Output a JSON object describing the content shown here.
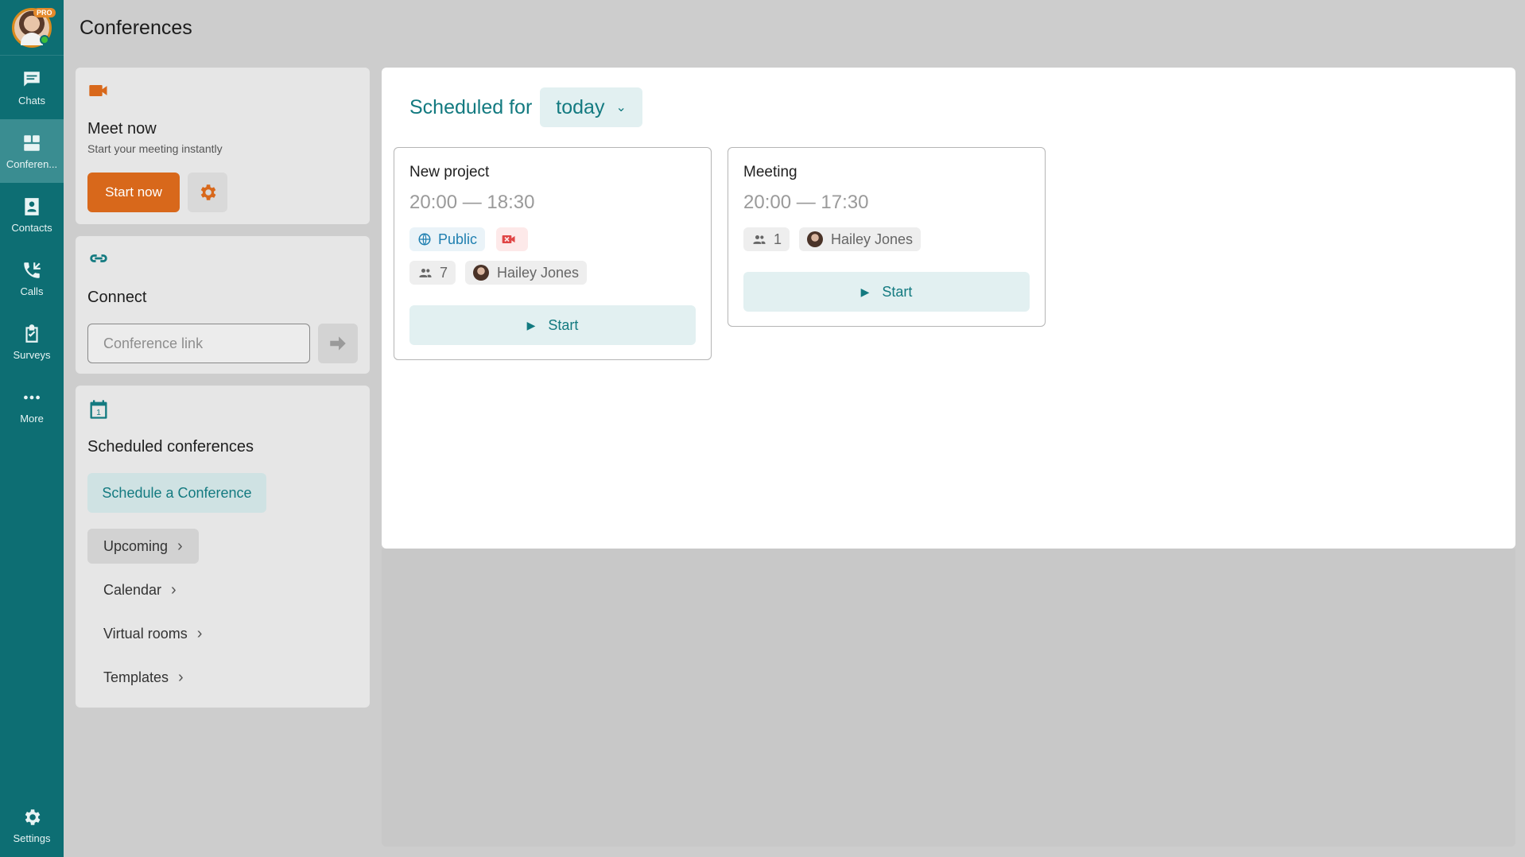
{
  "colors": {
    "sidebar_bg": "#0d6e73",
    "accent_teal": "#137a80",
    "accent_orange": "#d8681b"
  },
  "profile": {
    "badge": "PRO"
  },
  "sidebar": {
    "items": [
      {
        "label": "Chats",
        "icon": "chat-icon"
      },
      {
        "label": "Conferen...",
        "icon": "conference-icon"
      },
      {
        "label": "Contacts",
        "icon": "contacts-icon"
      },
      {
        "label": "Calls",
        "icon": "calls-icon"
      },
      {
        "label": "Surveys",
        "icon": "surveys-icon"
      },
      {
        "label": "More",
        "icon": "more-icon"
      }
    ],
    "settings_label": "Settings"
  },
  "header": {
    "title": "Conferences"
  },
  "meet_now": {
    "title": "Meet now",
    "subtitle": "Start your meeting instantly",
    "start_label": "Start now"
  },
  "connect": {
    "title": "Connect",
    "placeholder": "Conference link"
  },
  "scheduled": {
    "title": "Scheduled conferences",
    "schedule_button": "Schedule a Conference",
    "links": [
      "Upcoming",
      "Calendar",
      "Virtual rooms",
      "Templates"
    ]
  },
  "main": {
    "scheduled_for_label": "Scheduled for",
    "period": "today",
    "conferences": [
      {
        "title": "New project",
        "time": "20:00 — 18:30",
        "visibility": "Public",
        "participants": "7",
        "owner": "Hailey Jones",
        "start_label": "Start"
      },
      {
        "title": "Meeting",
        "time": "20:00 — 17:30",
        "participants": "1",
        "owner": "Hailey Jones",
        "start_label": "Start"
      }
    ]
  }
}
